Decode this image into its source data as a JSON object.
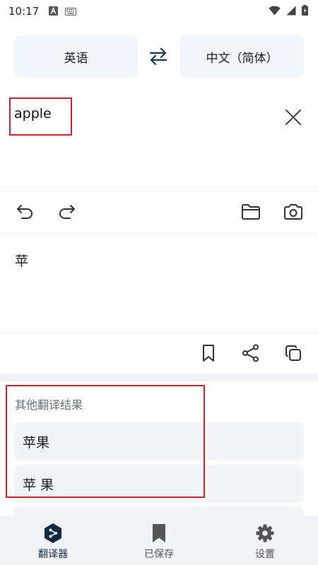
{
  "status_bar": {
    "time": "10:17",
    "icons": [
      "font-a-icon",
      "keyboard-icon",
      "wifi-icon",
      "signal-icon",
      "battery-icon"
    ]
  },
  "languages": {
    "source": "英语",
    "target": "中文（简体）"
  },
  "input": {
    "text": "apple"
  },
  "output": {
    "text": "苹"
  },
  "alternatives": {
    "title": "其他翻译结果",
    "items": [
      "苹果",
      "苹 果"
    ]
  },
  "nav": {
    "items": [
      {
        "label": "翻译器",
        "icon": "translator-icon",
        "active": true
      },
      {
        "label": "已保存",
        "icon": "bookmark-icon",
        "active": false
      },
      {
        "label": "设置",
        "icon": "gear-icon",
        "active": false
      }
    ]
  },
  "colors": {
    "accent": "#0f2b46",
    "lang_button_bg": "#f0f7fa",
    "highlight_border": "#c6262e",
    "nav_bg": "#f2f3f7"
  }
}
